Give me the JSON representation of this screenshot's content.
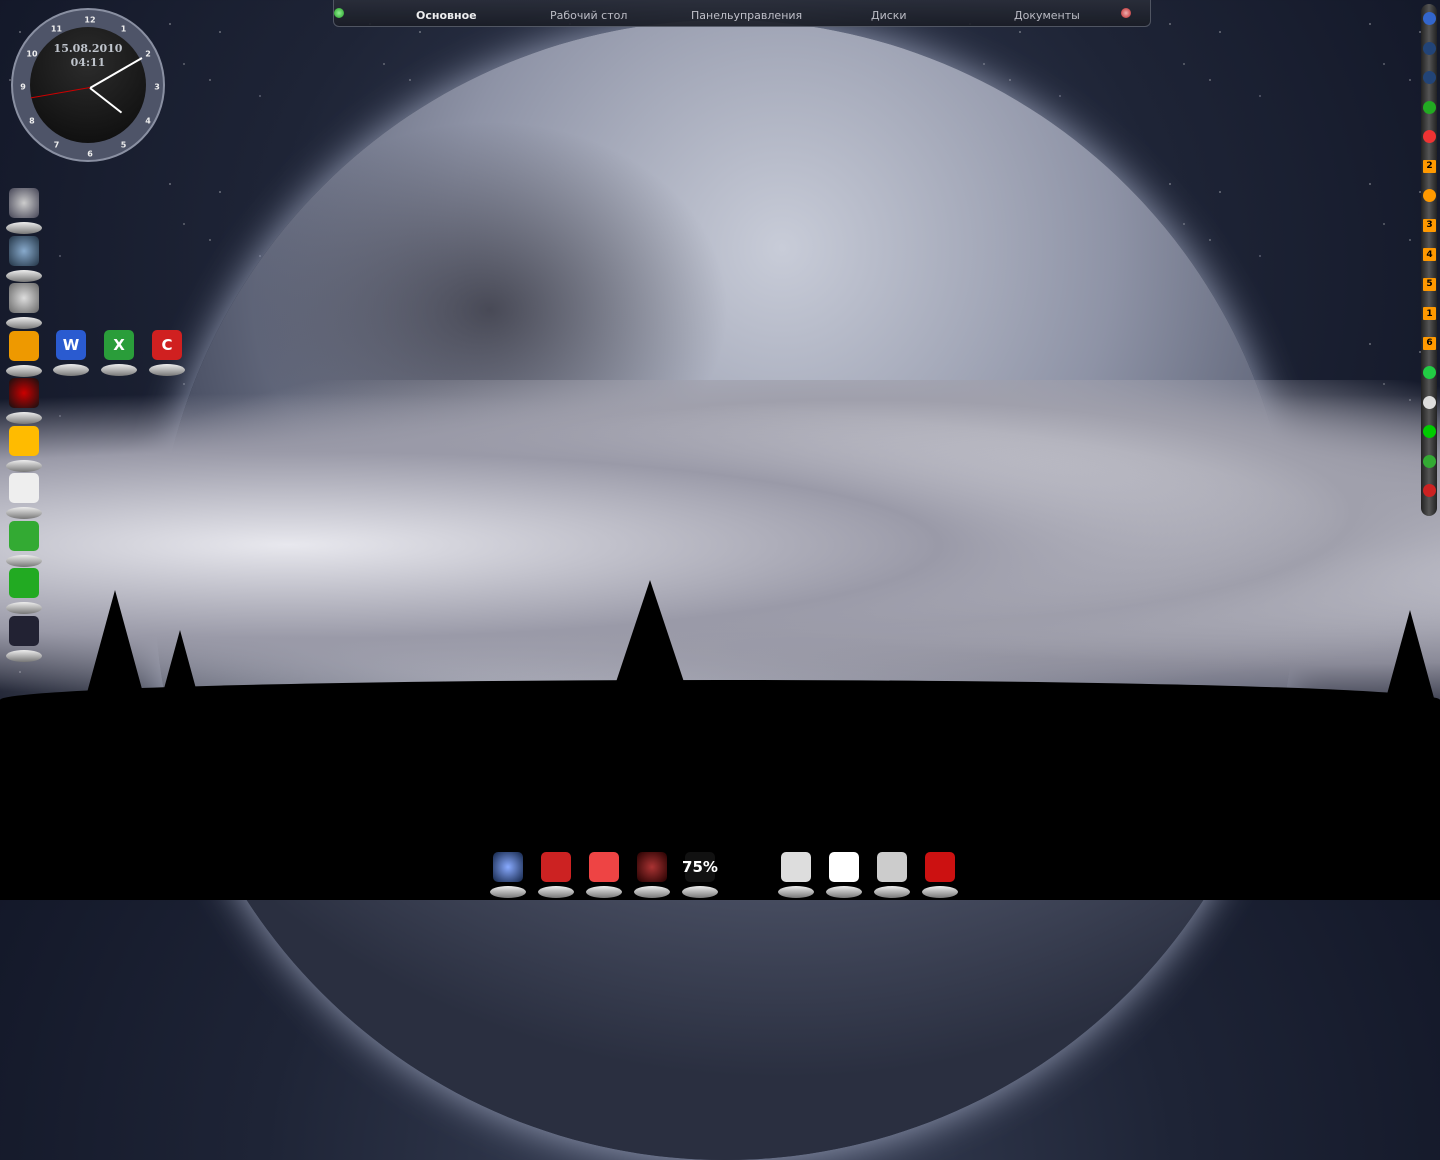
{
  "top_menu": {
    "tabs": [
      "Основное",
      "Рабочий стол",
      "Панельуправления",
      "Диски",
      "Документы"
    ],
    "active": "Основное"
  },
  "clock": {
    "date": "15.08.2010",
    "time": "04:11",
    "numbers": [
      "12",
      "1",
      "2",
      "3",
      "4",
      "5",
      "6",
      "7",
      "8",
      "9",
      "10",
      "11"
    ]
  },
  "left_dock": [
    "webcam",
    "globe",
    "settings",
    "office",
    "kaspersky",
    "box",
    "notepad",
    "network",
    "utorrent",
    "terminal"
  ],
  "left_dock_row": [
    "W",
    "X",
    "C"
  ],
  "bottom_dock": {
    "left": [
      "download",
      "floppy",
      "settings",
      "opera-o",
      "cpu-monitor"
    ],
    "cpu_percent": "75%",
    "right": [
      "window-floppy",
      "window-opera",
      "window-terminal",
      "cubes"
    ]
  },
  "right_bar": {
    "numbers": [
      "2",
      "3",
      "4",
      "5",
      "1",
      "6"
    ]
  }
}
